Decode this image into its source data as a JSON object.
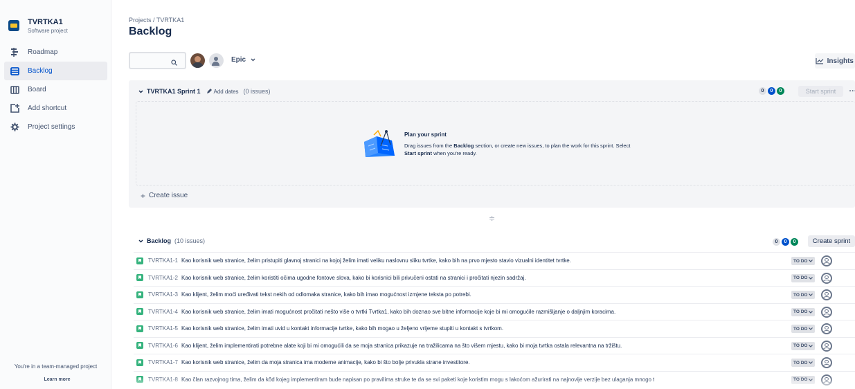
{
  "project": {
    "name": "TVRTKA1",
    "type": "Software project"
  },
  "sidebar": {
    "items": [
      {
        "label": "Roadmap",
        "icon": "roadmap-icon"
      },
      {
        "label": "Backlog",
        "icon": "backlog-icon",
        "active": true
      },
      {
        "label": "Board",
        "icon": "board-icon"
      },
      {
        "label": "Add shortcut",
        "icon": "add-shortcut-icon"
      },
      {
        "label": "Project settings",
        "icon": "gear-icon"
      }
    ],
    "footer_text": "You're in a team-managed project",
    "learn_more": "Learn more"
  },
  "header": {
    "breadcrumb": "Projects  /  TVRTKA1",
    "title": "Backlog"
  },
  "toolbar": {
    "search_placeholder": "",
    "epic_label": "Epic",
    "insights_label": "Insights"
  },
  "sprint": {
    "name": "TVRTKA1 Sprint 1",
    "add_dates": "Add dates",
    "count": "(0 issues)",
    "badges": [
      "0",
      "0",
      "0"
    ],
    "start_sprint": "Start sprint",
    "more": "···",
    "plan_title": "Plan your sprint",
    "plan_desc_1": "Drag issues from the ",
    "plan_desc_bold_1": "Backlog",
    "plan_desc_2": " section, or create new issues, to plan the work for this sprint. Select ",
    "plan_desc_bold_2": "Start sprint",
    "plan_desc_3": " when you're ready.",
    "create_issue": "Create issue"
  },
  "backlog": {
    "name": "Backlog",
    "count": "(10 issues)",
    "badges": [
      "0",
      "0",
      "0"
    ],
    "create_sprint": "Create sprint",
    "issues": [
      {
        "key": "TVRTKA1-1",
        "summary": "Kao korisnik web stranice, želim pristupiti glavnoj stranici na kojoj želim imati veliku naslovnu sliku tvrtke, kako bih na prvo mjesto stavio vizualni identitet tvrtke.",
        "status": "TO DO"
      },
      {
        "key": "TVRTKA1-2",
        "summary": "Kao korisnik web stranice, želim koristiti očima ugodne fontove slova, kako bi korisnici bili privučeni ostati na stranici i pročitati njezin sadržaj.",
        "status": "TO DO"
      },
      {
        "key": "TVRTKA1-3",
        "summary": "Kao klijent, želim moći uređivati tekst nekih od odlomaka stranice, kako bih imao mogućnost izmjene teksta po potrebi.",
        "status": "TO DO"
      },
      {
        "key": "TVRTKA1-4",
        "summary": "Kao korisnik web stranice, želim imati mogućnost pročitati nešto više o tvrtki Tvrtka1, kako bih doznao sve bitne informacije koje bi mi omogućile razmišljanje o daljnjim koracima.",
        "status": "TO DO"
      },
      {
        "key": "TVRTKA1-5",
        "summary": "Kao korisnik web stranice, želim imati uvid u kontakt informacije tvrtke, kako bih mogao u željeno vrijeme stupiti u kontakt s tvrtkom.",
        "status": "TO DO"
      },
      {
        "key": "TVRTKA1-6",
        "summary": "Kao klijent, želim implementirati potrebne alate koji bi mi omogućili da se moja stranica prikazuje na tražilicama na što višem mjestu, kako bi moja tvrtka ostala relevantna na tržištu.",
        "status": "TO DO"
      },
      {
        "key": "TVRTKA1-7",
        "summary": "Kao korisnik web stranice, želim da moja stranica ima moderne animacije, kako bi što bolje privukla strane investitore.",
        "status": "TO DO"
      },
      {
        "key": "TVRTKA1-8",
        "summary": "Kao član razvojnog tima, želim da kôd kojeg implementiram bude napisan po pravilima struke te da se svi paketi koje koristim mogu s lakoćom ažurirati na najnovije verzije bez ulaganja mnogo t",
        "status": "TO DO"
      }
    ]
  }
}
